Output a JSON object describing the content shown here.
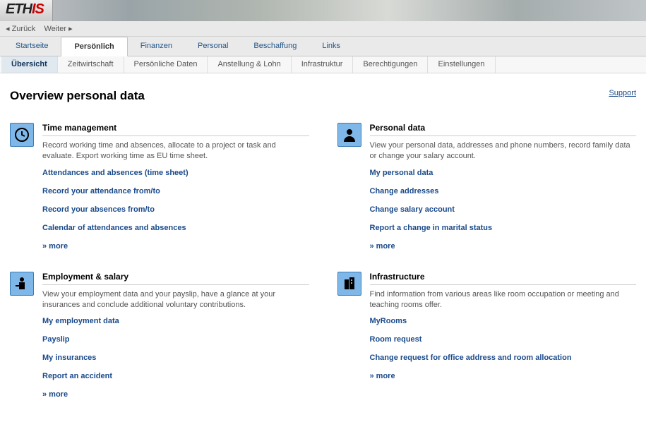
{
  "logo": {
    "part1": "ETH",
    "part2": "IS"
  },
  "history": {
    "back": "Zurück",
    "forward": "Weiter"
  },
  "mainTabs": [
    "Startseite",
    "Persönlich",
    "Finanzen",
    "Personal",
    "Beschaffung",
    "Links"
  ],
  "mainActive": 1,
  "subTabs": [
    "Übersicht",
    "Zeitwirtschaft",
    "Persönliche Daten",
    "Anstellung & Lohn",
    "Infrastruktur",
    "Berechtigungen",
    "Einstellungen"
  ],
  "subActive": 0,
  "pageTitle": "Overview personal data",
  "support": "Support",
  "moreLabel": "» more",
  "sections": [
    {
      "title": "Time management",
      "desc": "Record working time and absences, allocate to a project or task and evaluate. Export working time as EU time sheet.",
      "links": [
        "Attendances and absences (time sheet)",
        "Record your attendance from/to",
        "Record your absences from/to",
        "Calendar of attendances and absences"
      ],
      "more": true,
      "icon": "clock"
    },
    {
      "title": "Personal data",
      "desc": "View your personal data, addresses and phone numbers, record family data or change your salary account.",
      "links": [
        "My personal data",
        "Change addresses",
        "Change salary account",
        "Report a change in marital status"
      ],
      "more": true,
      "icon": "person"
    },
    {
      "title": "Employment & salary",
      "desc": "View your employment data and your payslip, have a glance at your insurances and conclude additional voluntary contributions.",
      "links": [
        "My employment data",
        "Payslip",
        "My insurances",
        "Report an accident"
      ],
      "more": true,
      "icon": "employee"
    },
    {
      "title": "Infrastructure",
      "desc": "Find information from various areas like room occupation or meeting and teaching rooms offer.",
      "links": [
        "MyRooms",
        "Room request",
        "Change request for office address and room allocation"
      ],
      "more": true,
      "icon": "building"
    }
  ]
}
